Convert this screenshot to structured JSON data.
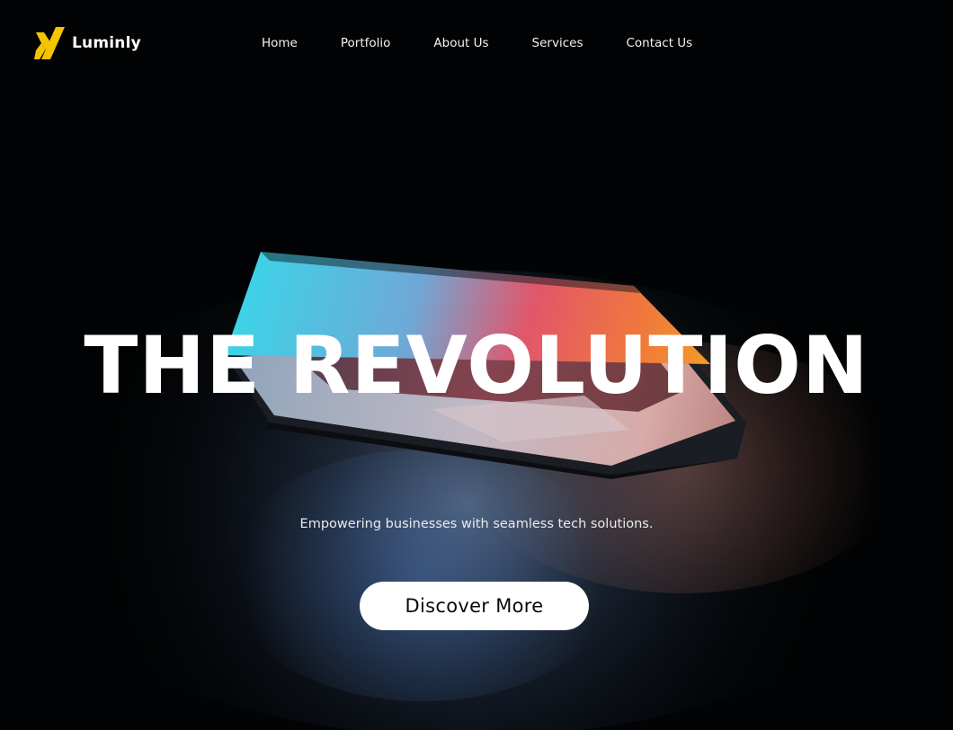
{
  "brand": {
    "name": "Luminly",
    "logo_icon": "x-logo-icon",
    "accent_color": "#f5c400"
  },
  "nav": {
    "items": [
      {
        "label": "Home"
      },
      {
        "label": "Portfolio"
      },
      {
        "label": "About Us"
      },
      {
        "label": "Services"
      },
      {
        "label": "Contact Us"
      }
    ]
  },
  "hero": {
    "title": "THE REVOLUTION",
    "subtitle": "Empowering businesses with seamless tech solutions.",
    "cta_label": "Discover More",
    "background_image": "laptop-photo"
  },
  "colors": {
    "background": "#020304",
    "text": "#ffffff",
    "button_bg": "#ffffff",
    "button_text": "#0a0a0a"
  }
}
